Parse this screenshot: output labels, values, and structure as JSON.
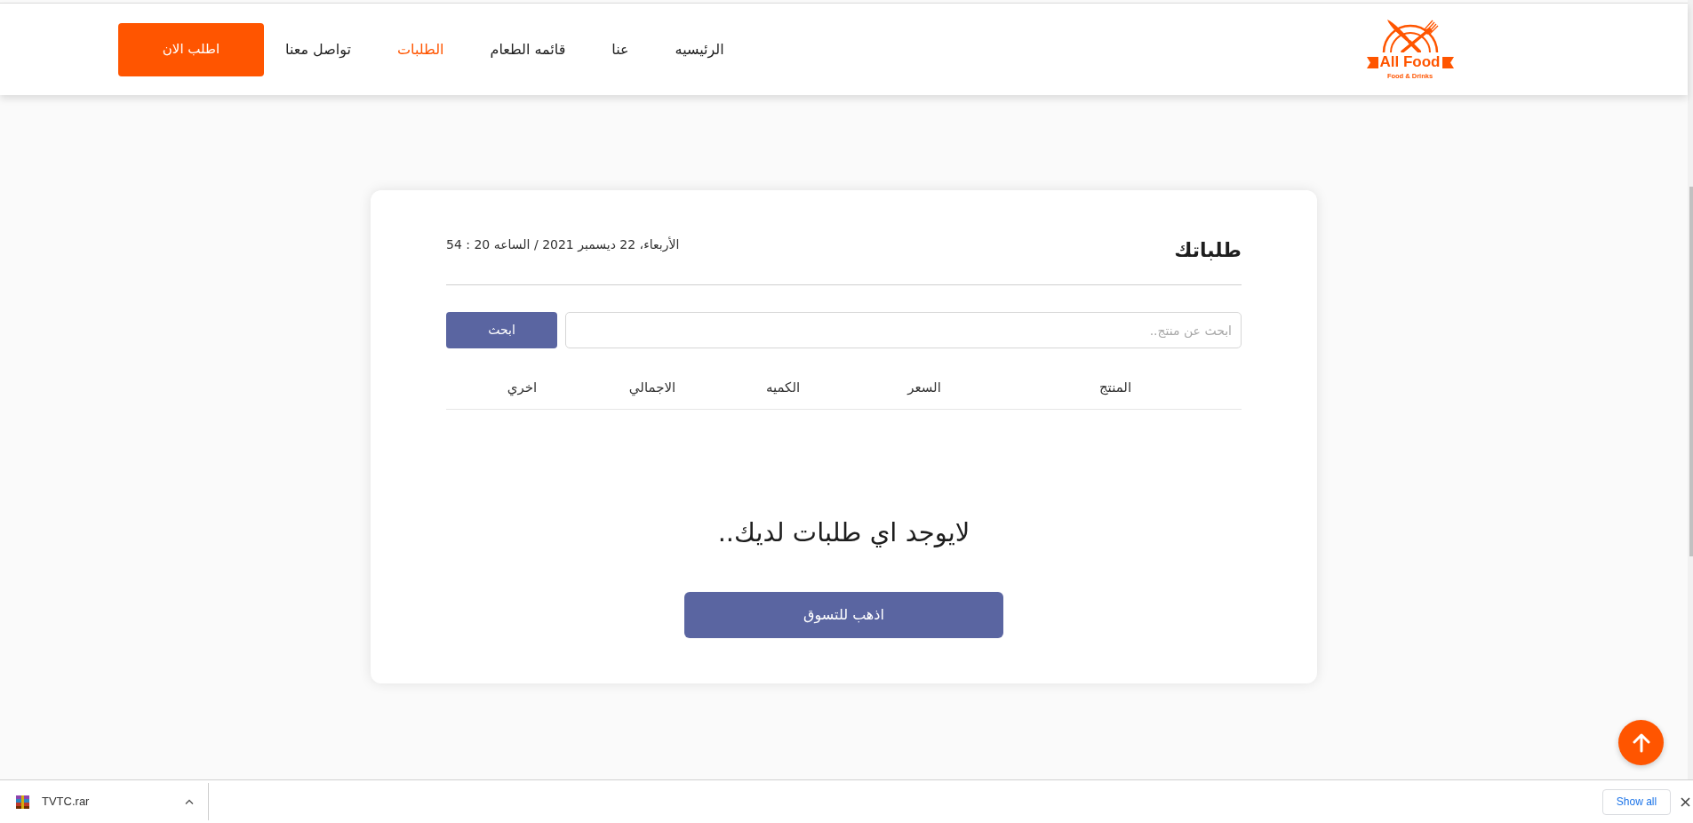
{
  "header": {
    "logo": {
      "name": "All Food",
      "tagline": "Food & Drinks"
    },
    "nav": [
      {
        "label": "الرئيسيه",
        "selected": false
      },
      {
        "label": "عنا",
        "selected": false
      },
      {
        "label": "قائمه الطعام",
        "selected": false
      },
      {
        "label": "الطلبات",
        "selected": true
      },
      {
        "label": "تواصل معنا",
        "selected": false
      }
    ],
    "order_button": "اطلب الان"
  },
  "orders_card": {
    "title": "طلباتك",
    "date": "الأربعاء، 22 ديسمبر 2021 / الساعه 20 : 54",
    "search": {
      "placeholder": "ابحث عن منتج..",
      "button": "ابحث"
    },
    "table": {
      "columns": [
        "المنتج",
        "السعر",
        "الكميه",
        "الاجمالي",
        "اخري"
      ]
    },
    "empty_message": "لايوجد اي طلبات لديك..",
    "shop_button": "اذهب للتسوق"
  },
  "download_bar": {
    "files": [
      {
        "name": "TVTC.rar"
      }
    ],
    "show_all": "Show all"
  }
}
